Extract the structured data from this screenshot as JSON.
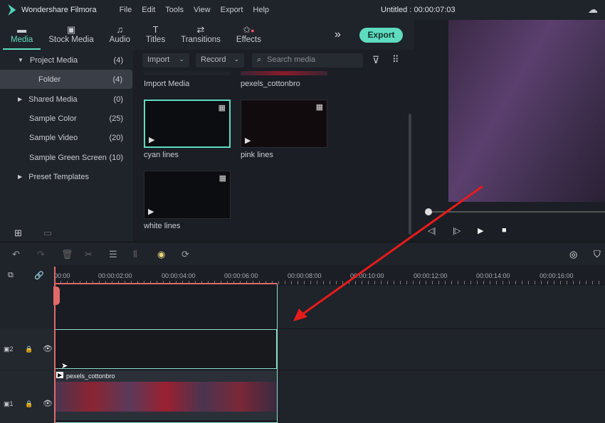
{
  "app": {
    "name": "Wondershare Filmora",
    "title": "Untitled : 00:00:07:03"
  },
  "menu": [
    "File",
    "Edit",
    "Tools",
    "View",
    "Export",
    "Help"
  ],
  "tabs": [
    {
      "label": "Media",
      "icon": "folder-icon"
    },
    {
      "label": "Stock Media",
      "icon": "stock-icon"
    },
    {
      "label": "Audio",
      "icon": "music-icon"
    },
    {
      "label": "Titles",
      "icon": "text-icon"
    },
    {
      "label": "Transitions",
      "icon": "transition-icon"
    },
    {
      "label": "Effects",
      "icon": "effects-icon"
    }
  ],
  "export_label": "Export",
  "sidebar": [
    {
      "label": "Project Media",
      "count": "(4)"
    },
    {
      "label": "Folder",
      "count": "(4)"
    },
    {
      "label": "Shared Media",
      "count": "(0)"
    },
    {
      "label": "Sample Color",
      "count": "(25)"
    },
    {
      "label": "Sample Video",
      "count": "(20)"
    },
    {
      "label": "Sample Green Screen",
      "count": "(10)"
    },
    {
      "label": "Preset Templates",
      "count": ""
    }
  ],
  "media_toolbar": {
    "import": "Import",
    "record": "Record",
    "search_placeholder": "Search media"
  },
  "media": [
    "Import Media",
    "pexels_cottonbro",
    "cyan lines",
    "pink lines",
    "white lines"
  ],
  "ruler": [
    "00:00",
    "00:00:02:00",
    "00:00:04:00",
    "00:00:06:00",
    "00:00:08:00",
    "00:00:10:00",
    "00:00:12:00",
    "00:00:14:00",
    "00:00:16:00"
  ],
  "tracks": [
    "2",
    "1"
  ],
  "clip": "pexels_cottonbro",
  "accent": "#5fdcc0",
  "annotation_color": "#e51c1c"
}
